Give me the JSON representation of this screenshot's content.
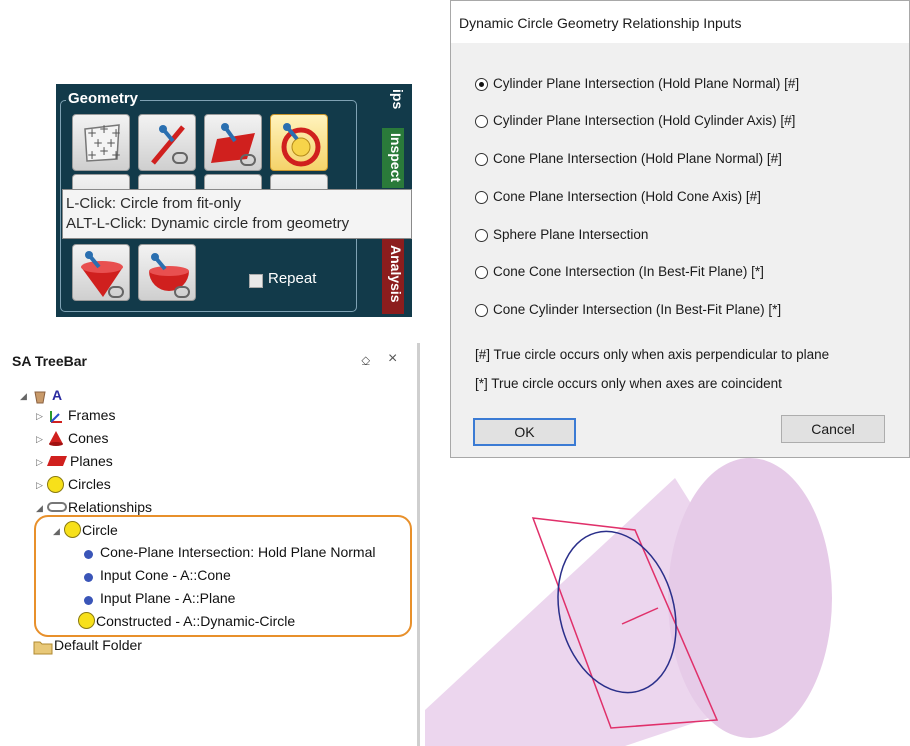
{
  "geometry_panel": {
    "title": "Geometry",
    "tab_top": "ips",
    "tab_inspect": "Inspect",
    "tab_analysis": "Analysis",
    "tooltip_line1": "L-Click: Circle from fit-only",
    "tooltip_line2": "ALT-L-Click: Dynamic circle from geometry",
    "repeat_label": "Repeat",
    "icons": [
      "point-cloud-icon",
      "line-link-icon",
      "plane-link-icon",
      "dynamic-circle-icon",
      "cone-link-icon",
      "sphere-link-icon"
    ]
  },
  "treebar": {
    "title": "SA TreeBar",
    "pin": "⎐",
    "close": "×",
    "root": "A",
    "items": [
      {
        "label": "Frames"
      },
      {
        "label": "Cones"
      },
      {
        "label": "Planes"
      },
      {
        "label": "Circles"
      },
      {
        "label": "Relationships"
      }
    ],
    "relationship": {
      "label": "Circle",
      "children": [
        "Cone-Plane Intersection: Hold Plane Normal",
        "Input Cone - A::Cone",
        "Input Plane - A::Plane"
      ],
      "constructed": "Constructed - A::Dynamic-Circle"
    },
    "default_folder": "Default Folder"
  },
  "dialog": {
    "title": "Dynamic Circle Geometry Relationship Inputs",
    "options": [
      "Cylinder Plane Intersection (Hold Plane Normal) [#]",
      "Cylinder Plane Intersection (Hold Cylinder Axis) [#]",
      "Cone Plane Intersection (Hold Plane Normal) [#]",
      "Cone Plane Intersection (Hold Cone Axis) [#]",
      "Sphere Plane Intersection",
      "Cone Cone Intersection (In Best-Fit Plane) [*]",
      "Cone Cylinder Intersection (In Best-Fit Plane) [*]"
    ],
    "selected_index": 0,
    "note1": "[#] True circle occurs only when axis perpendicular to plane",
    "note2": "[*] True circle occurs only when axes are coincident",
    "ok": "OK",
    "cancel": "Cancel"
  },
  "colors": {
    "panel_bg": "#123a4a",
    "highlight": "#e8902b",
    "cone": "#ecd6ee",
    "plane_outline": "#e0306a",
    "circle_outline": "#2a2f8a"
  }
}
